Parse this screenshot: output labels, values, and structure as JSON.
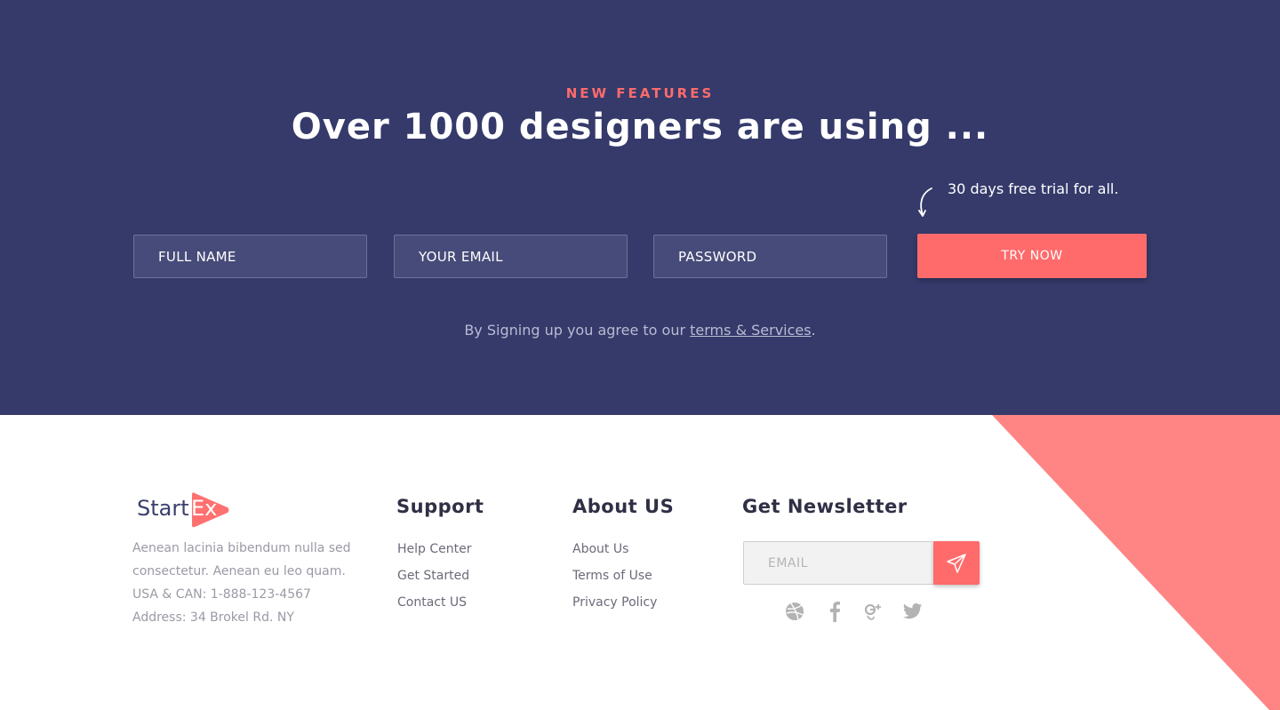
{
  "signup": {
    "eyebrow": "NEW FEATURES",
    "headline": "Over 1000 designers are using ...",
    "trial_note": "30 days free trial for all.",
    "fields": {
      "full_name_placeholder": "FULL NAME",
      "email_placeholder": "YOUR EMAIL",
      "password_placeholder": "PASSWORD"
    },
    "cta_label": "TRY NOW",
    "terms_prefix": "By Signing up you agree to our ",
    "terms_link": "terms & Services",
    "terms_suffix": "."
  },
  "footer": {
    "logo": {
      "start": "Start",
      "ex": "Ex"
    },
    "about_lines": [
      "Aenean lacinia bibendum nulla sed",
      "consectetur. Aenean eu leo quam.",
      "USA &  CAN: 1-888-123-4567",
      "Address: 34 Brokel Rd. NY"
    ],
    "support": {
      "title": "Support",
      "links": [
        "Help Center",
        "Get Started",
        "Contact US"
      ]
    },
    "about_us": {
      "title": "About US",
      "links": [
        "About Us",
        "Terms of Use",
        "Privacy Policy"
      ]
    },
    "newsletter": {
      "title": "Get Newsletter",
      "email_placeholder": "EMAIL",
      "send_icon": "paper-plane-icon"
    },
    "social_icons": [
      "dribbble-icon",
      "facebook-icon",
      "google-plus-icon",
      "twitter-icon"
    ]
  },
  "colors": {
    "hero_bg": "#353a6b",
    "accent": "#ff6b6b",
    "corner_accent": "#ff8585"
  }
}
